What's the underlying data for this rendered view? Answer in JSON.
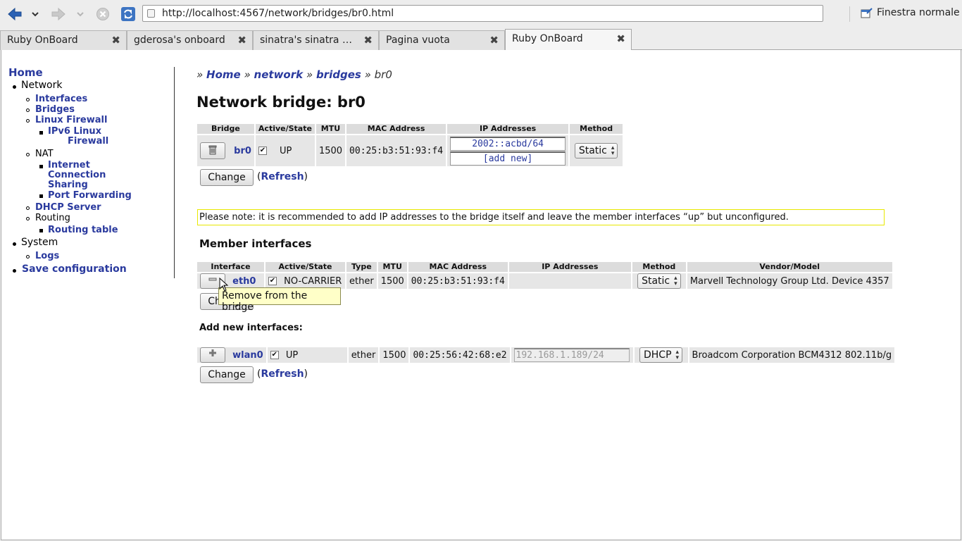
{
  "browser": {
    "url": "http://localhost:4567/network/bridges/br0.html",
    "window_mode": "Finestra normale",
    "tabs": [
      {
        "label": "Ruby OnBoard"
      },
      {
        "label": "gderosa's onboard"
      },
      {
        "label": "sinatra's sinatra at master"
      },
      {
        "label": "Pagina vuota"
      },
      {
        "label": "Ruby OnBoard"
      }
    ]
  },
  "sidebar": {
    "home": "Home",
    "network": "Network",
    "interfaces": "Interfaces",
    "bridges": "Bridges",
    "linux_firewall": "Linux Firewall",
    "ipv6_firewall_1": "IPv6 Linux",
    "ipv6_firewall_2": "Firewall",
    "nat": "NAT",
    "ics_1": "Internet",
    "ics_2": "Connection",
    "ics_3": "Sharing",
    "port_forwarding": "Port Forwarding",
    "dhcp_server": "DHCP Server",
    "routing": "Routing",
    "routing_table": "Routing table",
    "system": "System",
    "logs": "Logs",
    "save_config": "Save configuration"
  },
  "breadcrumb": {
    "sep": "»",
    "home": "Home",
    "network": "network",
    "bridges": "bridges",
    "current": "br0"
  },
  "page_title": "Network bridge: br0",
  "bridge_table": {
    "headers": [
      "Bridge",
      "Active/State",
      "MTU",
      "MAC Address",
      "IP Addresses",
      "Method"
    ],
    "row": {
      "name": "br0",
      "state": "UP",
      "mtu": "1500",
      "mac": "00:25:b3:51:93:f4",
      "ip": "2002::acbd/64",
      "ip_add": "[add new]",
      "method": "Static"
    }
  },
  "buttons": {
    "change": "Change",
    "refresh": "Refresh",
    "open_paren": "(",
    "close_paren": ")"
  },
  "note": "Please note: it is recommended to add IP addresses to the bridge itself and leave the member interfaces “up” but unconfigured.",
  "members_heading": "Member interfaces",
  "members_table": {
    "headers": [
      "Interface",
      "Active/State",
      "Type",
      "MTU",
      "MAC Address",
      "IP Addresses",
      "Method",
      "Vendor/Model"
    ],
    "rows": [
      {
        "name": "eth0",
        "state": "NO-CARRIER",
        "type": "ether",
        "mtu": "1500",
        "mac": "00:25:b3:51:93:f4",
        "ip": "",
        "method": "Static",
        "vendor": "Marvell Technology Group Ltd. Device 4357"
      }
    ]
  },
  "tooltip": "Remove from the bridge",
  "add_new_heading": "Add new interfaces:",
  "new_table": {
    "rows": [
      {
        "name": "wlan0",
        "state": "UP",
        "type": "ether",
        "mtu": "1500",
        "mac": "00:25:56:42:68:e2",
        "ip_placeholder": "192.168.1.189/24",
        "method": "DHCP",
        "vendor": "Broadcom Corporation BCM4312 802.11b/g"
      }
    ]
  }
}
